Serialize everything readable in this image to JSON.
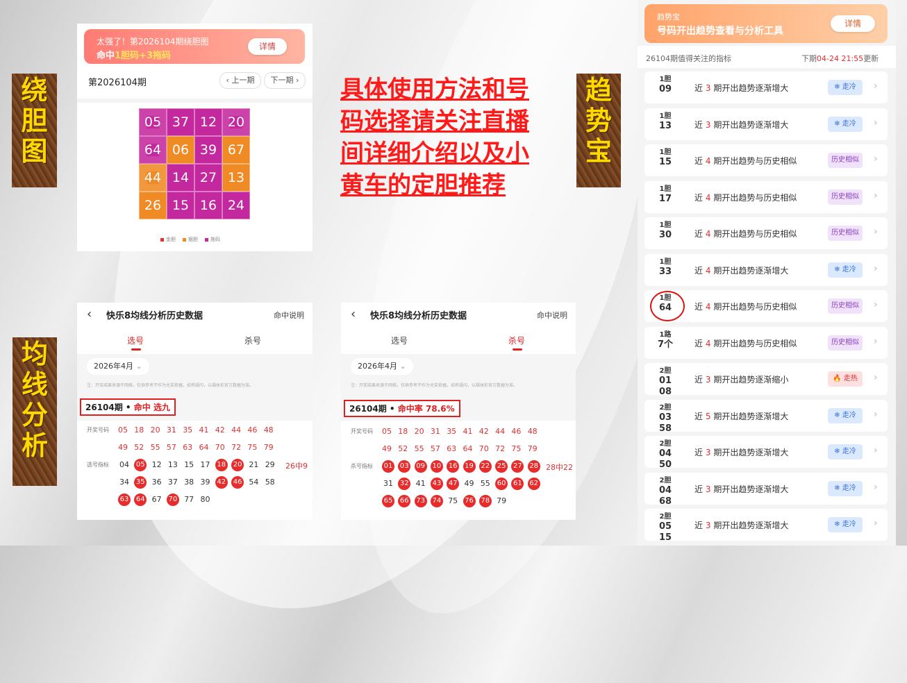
{
  "side_labels": {
    "raodan": [
      "绕",
      "胆",
      "图"
    ],
    "qushibao": [
      "趋",
      "势",
      "宝"
    ],
    "junxian": [
      "均",
      "线",
      "分",
      "析"
    ]
  },
  "center_note": "具体使用方法和号码选择请关注直播间详细介绍以及小黄车的定胆推荐",
  "raodan_panel": {
    "banner_line1": "太强了！第2026104期绕胆图",
    "banner_line2_prefix": "命中",
    "banner_line2_highlight": "1胆码+3拖码",
    "detail_btn": "详情",
    "period": "第2026104期",
    "prev_btn": "上一期",
    "next_btn": "下一期",
    "grid": [
      {
        "n": "05",
        "c": "#c4289e",
        "stamp": true
      },
      {
        "n": "37",
        "c": "#c4289e",
        "stamp": false
      },
      {
        "n": "12",
        "c": "#c4289e",
        "stamp": false
      },
      {
        "n": "20",
        "c": "#c4289e",
        "stamp": true
      },
      {
        "n": "64",
        "c": "#c4289e",
        "stamp": true
      },
      {
        "n": "06",
        "c": "#f08a24",
        "stamp": false
      },
      {
        "n": "39",
        "c": "#c4289e",
        "stamp": false
      },
      {
        "n": "67",
        "c": "#f08a24",
        "stamp": false
      },
      {
        "n": "44",
        "c": "#f08a24",
        "stamp": true
      },
      {
        "n": "14",
        "c": "#c4289e",
        "stamp": false
      },
      {
        "n": "27",
        "c": "#c4289e",
        "stamp": false
      },
      {
        "n": "13",
        "c": "#f08a24",
        "stamp": false
      },
      {
        "n": "26",
        "c": "#f08a24",
        "stamp": false
      },
      {
        "n": "15",
        "c": "#c4289e",
        "stamp": false
      },
      {
        "n": "16",
        "c": "#c4289e",
        "stamp": false
      },
      {
        "n": "24",
        "c": "#c4289e",
        "stamp": false
      }
    ],
    "legend": [
      {
        "label": "金胆",
        "color": "#e83030"
      },
      {
        "label": "银胆",
        "color": "#f08a24"
      },
      {
        "label": "拖码",
        "color": "#c4289e"
      }
    ]
  },
  "junxian_left": {
    "title": "快乐8均线分析历史数据",
    "help": "命中说明",
    "tab_active": "选号",
    "tab_other": "杀号",
    "month": "2026年4月",
    "note": "注：开奖结果来源于网络，仅供参考不作为兑奖依据。如有疑问，以福体彩官方数据为准。",
    "hit_period": "26104期 • ",
    "hit_result": "命中 选九",
    "draw_label": "开奖号码",
    "draw_row1": [
      "05",
      "18",
      "20",
      "31",
      "35",
      "41",
      "42",
      "44",
      "46",
      "48"
    ],
    "draw_row2": [
      "49",
      "52",
      "55",
      "57",
      "63",
      "64",
      "70",
      "72",
      "75",
      "79"
    ],
    "pick_label": "选号指标",
    "pick_summary": "26中9",
    "pick_rows": [
      [
        {
          "n": "04",
          "h": false
        },
        {
          "n": "05",
          "h": true
        },
        {
          "n": "12",
          "h": false
        },
        {
          "n": "13",
          "h": false
        },
        {
          "n": "15",
          "h": false
        },
        {
          "n": "17",
          "h": false
        },
        {
          "n": "18",
          "h": true
        },
        {
          "n": "20",
          "h": true
        },
        {
          "n": "21",
          "h": false
        },
        {
          "n": "29",
          "h": false
        }
      ],
      [
        {
          "n": "34",
          "h": false
        },
        {
          "n": "35",
          "h": true
        },
        {
          "n": "36",
          "h": false
        },
        {
          "n": "37",
          "h": false
        },
        {
          "n": "38",
          "h": false
        },
        {
          "n": "39",
          "h": false
        },
        {
          "n": "42",
          "h": true
        },
        {
          "n": "46",
          "h": true
        },
        {
          "n": "54",
          "h": false
        },
        {
          "n": "58",
          "h": false
        }
      ],
      [
        {
          "n": "63",
          "h": true
        },
        {
          "n": "64",
          "h": true
        },
        {
          "n": "67",
          "h": false
        },
        {
          "n": "70",
          "h": true
        },
        {
          "n": "77",
          "h": false
        },
        {
          "n": "80",
          "h": false
        }
      ]
    ]
  },
  "junxian_right": {
    "title": "快乐8均线分析历史数据",
    "help": "命中说明",
    "tab_other": "选号",
    "tab_active": "杀号",
    "month": "2026年4月",
    "note": "注：开奖结果来源于网络，仅供参考不作为兑奖依据。如有疑问，以福体彩官方数据为准。",
    "hit_period": "26104期 • ",
    "hit_result": "命中率 78.6%",
    "draw_label": "开奖号码",
    "draw_row1": [
      "05",
      "18",
      "20",
      "31",
      "35",
      "41",
      "42",
      "44",
      "46",
      "48"
    ],
    "draw_row2": [
      "49",
      "52",
      "55",
      "57",
      "63",
      "64",
      "70",
      "72",
      "75",
      "79"
    ],
    "kill_label": "杀号指标",
    "kill_summary": "28中22",
    "kill_rows": [
      [
        {
          "n": "01",
          "h": true
        },
        {
          "n": "03",
          "h": true
        },
        {
          "n": "09",
          "h": true
        },
        {
          "n": "10",
          "h": true
        },
        {
          "n": "16",
          "h": true
        },
        {
          "n": "19",
          "h": true
        },
        {
          "n": "22",
          "h": true
        },
        {
          "n": "25",
          "h": true
        },
        {
          "n": "27",
          "h": true
        },
        {
          "n": "28",
          "h": true
        }
      ],
      [
        {
          "n": "31",
          "h": false
        },
        {
          "n": "32",
          "h": true
        },
        {
          "n": "41",
          "h": false
        },
        {
          "n": "43",
          "h": true
        },
        {
          "n": "47",
          "h": true
        },
        {
          "n": "49",
          "h": false
        },
        {
          "n": "55",
          "h": false
        },
        {
          "n": "60",
          "h": true
        },
        {
          "n": "61",
          "h": true
        },
        {
          "n": "62",
          "h": true
        }
      ],
      [
        {
          "n": "65",
          "h": true
        },
        {
          "n": "66",
          "h": true
        },
        {
          "n": "73",
          "h": true
        },
        {
          "n": "74",
          "h": true
        },
        {
          "n": "75",
          "h": false
        },
        {
          "n": "76",
          "h": true
        },
        {
          "n": "78",
          "h": true
        },
        {
          "n": "79",
          "h": false
        }
      ]
    ]
  },
  "qushibao_panel": {
    "banner_small": "趋势宝",
    "banner_title": "号码开出趋势查看与分析工具",
    "detail_btn": "详情",
    "section_left": "26104期值得关注的指标",
    "section_right_prefix": "下期",
    "section_right_time": "04-24 21:55",
    "section_right_suffix": "更新",
    "rows": [
      {
        "k1": "1胆",
        "k2": "09",
        "pre": "近",
        "n": "3",
        "post": "期开出趋势逐渐增大",
        "tag": "❄ 走冷",
        "type": "cold"
      },
      {
        "k1": "1胆",
        "k2": "13",
        "pre": "近",
        "n": "3",
        "post": "期开出趋势逐渐增大",
        "tag": "❄ 走冷",
        "type": "cold"
      },
      {
        "k1": "1胆",
        "k2": "15",
        "pre": "近",
        "n": "4",
        "post": "期开出趋势与历史相似",
        "tag": "历史相似",
        "type": "hist"
      },
      {
        "k1": "1胆",
        "k2": "17",
        "pre": "近",
        "n": "4",
        "post": "期开出趋势与历史相似",
        "tag": "历史相似",
        "type": "hist"
      },
      {
        "k1": "1胆",
        "k2": "30",
        "pre": "近",
        "n": "4",
        "post": "期开出趋势与历史相似",
        "tag": "历史相似",
        "type": "hist"
      },
      {
        "k1": "1胆",
        "k2": "33",
        "pre": "近",
        "n": "4",
        "post": "期开出趋势逐渐增大",
        "tag": "❄ 走冷",
        "type": "cold"
      },
      {
        "k1": "1胆",
        "k2": "64",
        "pre": "近",
        "n": "4",
        "post": "期开出趋势与历史相似",
        "tag": "历史相似",
        "type": "hist",
        "circled": true
      },
      {
        "k1": "1路",
        "k2": "7个",
        "pre": "近",
        "n": "4",
        "post": "期开出趋势与历史相似",
        "tag": "历史相似",
        "type": "hist"
      },
      {
        "k1": "2胆",
        "k2": "01 08",
        "pre": "近",
        "n": "3",
        "post": "期开出趋势逐渐缩小",
        "tag": "🔥 走热",
        "type": "hot"
      },
      {
        "k1": "2胆",
        "k2": "03 58",
        "pre": "近",
        "n": "5",
        "post": "期开出趋势逐渐增大",
        "tag": "❄ 走冷",
        "type": "cold"
      },
      {
        "k1": "2胆",
        "k2": "04 50",
        "pre": "近",
        "n": "3",
        "post": "期开出趋势逐渐增大",
        "tag": "❄ 走冷",
        "type": "cold"
      },
      {
        "k1": "2胆",
        "k2": "04 68",
        "pre": "近",
        "n": "3",
        "post": "期开出趋势逐渐增大",
        "tag": "❄ 走冷",
        "type": "cold"
      },
      {
        "k1": "2胆",
        "k2": "05 15",
        "pre": "近",
        "n": "3",
        "post": "期开出趋势逐渐增大",
        "tag": "❄ 走冷",
        "type": "cold"
      }
    ]
  }
}
